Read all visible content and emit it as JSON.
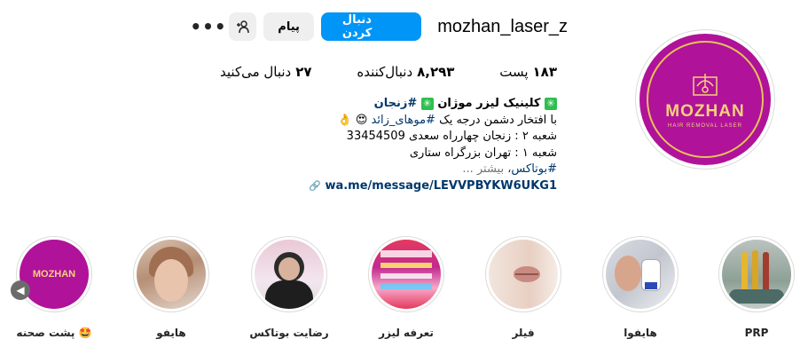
{
  "profile": {
    "username": "mozhan_laser_z",
    "follow_label": "دنبال کردن",
    "message_label": "پیام",
    "add_user_icon": "add-user-icon",
    "more_label": "•••",
    "avatar": {
      "brand": "MOZHAN",
      "sub": "HAIR REMOVAL LASER"
    }
  },
  "stats": {
    "posts_value": "۱۸۳",
    "posts_label": "پست",
    "followers_value": "۸,۲۹۳",
    "followers_label": "دنبال‌کننده",
    "following_value": "۲۷",
    "following_label": "دنبال می‌کنید"
  },
  "bio": {
    "title_text": "کلینیک لیزر موژان",
    "title_tag": "#زنجان",
    "green_glyph": "✳",
    "line2_text": "با افتخار دشمن درجه یک",
    "line2_tag": "#موهای_زائد",
    "line2_emoji": "😍 👌",
    "line3": "شعبه ۲ : زنجان چهارراه سعدی 33454509",
    "line4": "شعبه ۱ : تهران بزرگراه ستاری",
    "line5_tag": "#بوتاکس،",
    "line5_more": "بیشتر ...",
    "link_text": "wa.me/message/LEVVPBYKW6UKG1",
    "link_icon": "link-icon"
  },
  "highlights": [
    {
      "label": "پشت صحنه 🤩",
      "icon": "brand-logo"
    },
    {
      "label": "هایفو",
      "icon": "face-photo"
    },
    {
      "label": "رضایت بوتاکس",
      "icon": "person-photo"
    },
    {
      "label": "تعرفه لیزر",
      "icon": "price-flyer"
    },
    {
      "label": "فیلر",
      "icon": "lips-photo"
    },
    {
      "label": "هایفوا",
      "icon": "device-photo"
    },
    {
      "label": "PRP",
      "icon": "tubes-photo"
    }
  ],
  "colors": {
    "accent": "#0095f6",
    "brand_purple": "#b0129a",
    "brand_gold": "#f3d27a",
    "link": "#00376b"
  }
}
